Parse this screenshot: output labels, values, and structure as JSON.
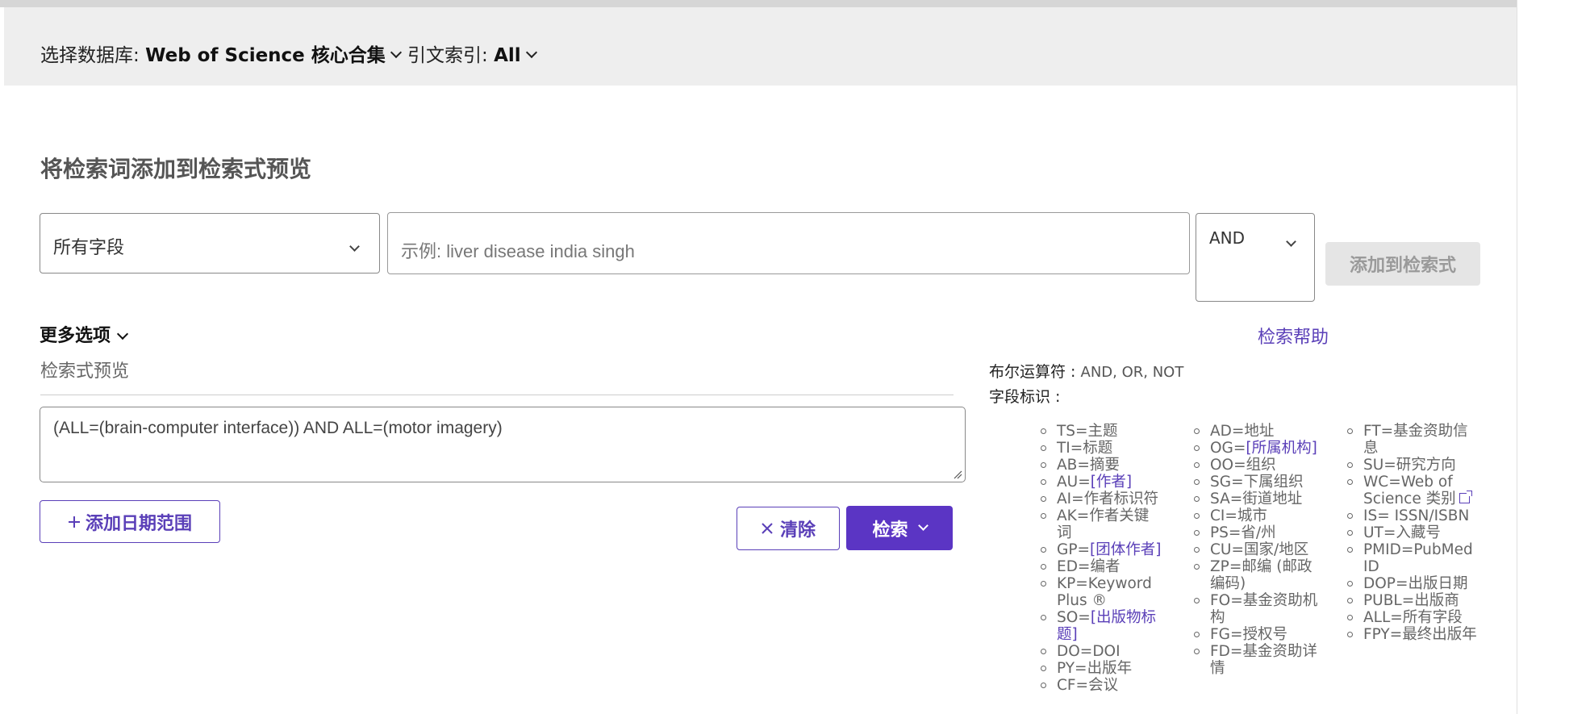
{
  "database_bar": {
    "db_label": "选择数据库:",
    "db_value": "Web of Science 核心合集",
    "citation_label": "引文索引:",
    "citation_value": "All"
  },
  "builder": {
    "heading": "将检索词添加到检索式预览",
    "field_select": "所有字段",
    "search_placeholder": "示例: liver disease india singh",
    "bool_select": "AND",
    "add_button": "添加到检索式"
  },
  "more_options": "更多选项",
  "search_help": "检索帮助",
  "preview": {
    "label": "检索式预览",
    "query": "(ALL=(brain-computer interface)) AND ALL=(motor imagery)"
  },
  "buttons": {
    "add_date_range": "添加日期范围",
    "clear": "清除",
    "search": "检索"
  },
  "help_panel": {
    "boolean_label": "布尔运算符 :",
    "boolean_ops": "AND, OR, NOT",
    "field_tags_label": "字段标识 :",
    "columns": [
      [
        {
          "code": "TS=",
          "text": "主题",
          "link": false
        },
        {
          "code": "TI=",
          "text": "标题",
          "link": false
        },
        {
          "code": "AB=",
          "text": "摘要",
          "link": false
        },
        {
          "code": "AU=",
          "text": "[作者]",
          "link": true
        },
        {
          "code": "AI=",
          "text": "作者标识符",
          "link": false
        },
        {
          "code": "AK=",
          "text": "作者关键词",
          "link": false
        },
        {
          "code": "GP=",
          "text": "[团体作者]",
          "link": true
        },
        {
          "code": "ED=",
          "text": "编者",
          "link": false
        },
        {
          "code": "KP=",
          "text": "Keyword Plus ®",
          "link": false
        },
        {
          "code": "SO=",
          "text": "[出版物标题]",
          "link": true
        },
        {
          "code": "DO=",
          "text": "DOI",
          "link": false
        },
        {
          "code": "PY=",
          "text": "出版年",
          "link": false
        },
        {
          "code": "CF=",
          "text": "会议",
          "link": false
        }
      ],
      [
        {
          "code": "AD=",
          "text": "地址",
          "link": false
        },
        {
          "code": "OG=",
          "text": "[所属机构]",
          "link": true
        },
        {
          "code": "OO=",
          "text": "组织",
          "link": false
        },
        {
          "code": "SG=",
          "text": "下属组织",
          "link": false
        },
        {
          "code": "SA=",
          "text": "街道地址",
          "link": false
        },
        {
          "code": "CI=",
          "text": "城市",
          "link": false
        },
        {
          "code": "PS=",
          "text": "省/州",
          "link": false
        },
        {
          "code": "CU=",
          "text": "国家/地区",
          "link": false
        },
        {
          "code": "ZP=",
          "text": "邮编 (邮政编码)",
          "link": false
        },
        {
          "code": "FO=",
          "text": "基金资助机构",
          "link": false
        },
        {
          "code": "FG=",
          "text": "授权号",
          "link": false
        },
        {
          "code": "FD=",
          "text": "基金资助详情",
          "link": false
        }
      ],
      [
        {
          "code": "FT=",
          "text": "基金资助信息",
          "link": false
        },
        {
          "code": "SU=",
          "text": "研究方向",
          "link": false
        },
        {
          "code": "WC=",
          "text": "Web of Science 类别",
          "link": false,
          "external": true
        },
        {
          "code": "IS=",
          "text": " ISSN/ISBN",
          "link": false
        },
        {
          "code": "UT=",
          "text": "入藏号",
          "link": false
        },
        {
          "code": "PMID=",
          "text": "PubMed ID",
          "link": false
        },
        {
          "code": "DOP=",
          "text": "出版日期",
          "link": false
        },
        {
          "code": "PUBL=",
          "text": "出版商",
          "link": false
        },
        {
          "code": "ALL=",
          "text": "所有字段",
          "link": false
        },
        {
          "code": "FPY=",
          "text": "最终出版年",
          "link": false
        }
      ]
    ]
  }
}
